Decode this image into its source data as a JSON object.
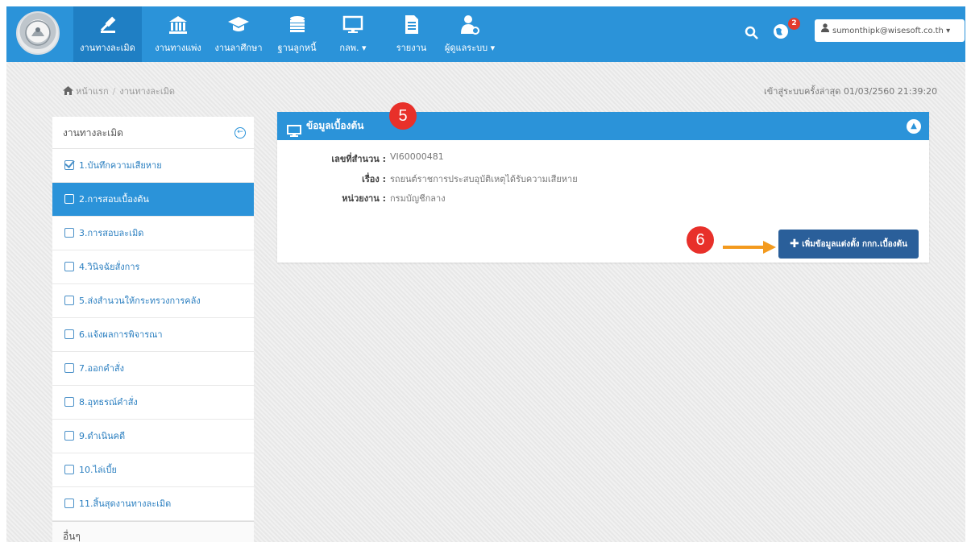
{
  "nav": {
    "items": [
      {
        "label": "งานทางละเมิด",
        "icon": "gavel-icon",
        "active": true
      },
      {
        "label": "งานทางแพ่ง",
        "icon": "bank-icon",
        "active": false
      },
      {
        "label": "งานลาศึกษา",
        "icon": "graduation-cap-icon",
        "active": false
      },
      {
        "label": "ฐานลูกหนี้",
        "icon": "coins-icon",
        "active": false
      },
      {
        "label": "กลพ. ▾",
        "icon": "monitor-icon",
        "active": false
      },
      {
        "label": "รายงาน",
        "icon": "document-icon",
        "active": false
      },
      {
        "label": "ผู้ดูแลระบบ ▾",
        "icon": "user-gear-icon",
        "active": false
      }
    ],
    "notification_count": "2",
    "user_email": "sumonthipk@wisesoft.co.th ▾"
  },
  "breadcrumb": {
    "home": "หน้าแรก",
    "sep": "/",
    "current": "งานทางละเมิด"
  },
  "last_login": "เข้าสู่ระบบครั้งล่าสุด 01/03/2560 21:39:20",
  "sidebar": {
    "title": "งานทางละเมิด",
    "items": [
      {
        "label": "1.บันทึกความเสียหาย",
        "checked": true,
        "active": false
      },
      {
        "label": "2.การสอบเบื้องต้น",
        "checked": false,
        "active": true
      },
      {
        "label": "3.การสอบละเมิด",
        "checked": false,
        "active": false
      },
      {
        "label": "4.วินิจฉัยสั่งการ",
        "checked": false,
        "active": false
      },
      {
        "label": "5.ส่งสำนวนให้กระทรวงการคลัง",
        "checked": false,
        "active": false
      },
      {
        "label": "6.แจ้งผลการพิจารณา",
        "checked": false,
        "active": false
      },
      {
        "label": "7.ออกคำสั่ง",
        "checked": false,
        "active": false
      },
      {
        "label": "8.อุทธรณ์คำสั่ง",
        "checked": false,
        "active": false
      },
      {
        "label": "9.ดำเนินคดี",
        "checked": false,
        "active": false
      },
      {
        "label": "10.ไล่เบี้ย",
        "checked": false,
        "active": false
      },
      {
        "label": "11.สิ้นสุดงานทางละเมิด",
        "checked": false,
        "active": false
      }
    ],
    "footer": "อื่นๆ"
  },
  "panel": {
    "title": "ข้อมูลเบื้องต้น",
    "fields": [
      {
        "key": "เลขที่สำนวน :",
        "value": "VI60000481"
      },
      {
        "key": "เรื่อง :",
        "value": "รถยนต์ราชการประสบอุบัติเหตุได้รับความเสียหาย"
      },
      {
        "key": "หน่วยงาน :",
        "value": "กรมบัญชีกลาง"
      }
    ],
    "add_button": "เพิ่มข้อมูลแต่งตั้ง กกก.เบื้องต้น"
  },
  "annotations": {
    "step5": "5",
    "step6": "6"
  },
  "colors": {
    "primary": "#2b93d9",
    "nav_active": "#1f7fc4",
    "button": "#2a5f9a",
    "marker": "#e8302a",
    "arrow": "#f39a1e"
  }
}
